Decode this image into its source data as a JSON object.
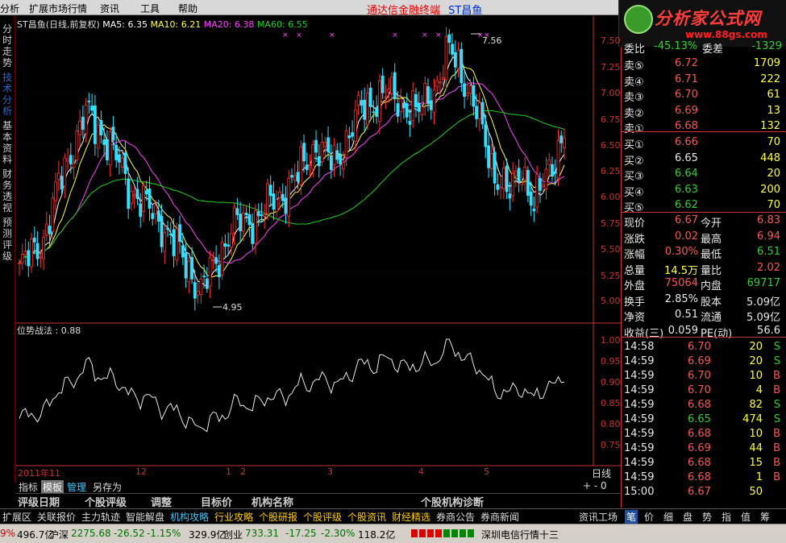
{
  "menubar": {
    "items": [
      "分析",
      "扩展市场行情",
      "资讯",
      "工具",
      "帮助"
    ],
    "center_title": "通达信金融终端",
    "stock_name": "ST昌鱼"
  },
  "logo": {
    "text": "分析家公式网",
    "url": "www.88gs.com"
  },
  "leftnav": {
    "items": [
      "分时走势",
      "技术分析",
      "基本资料",
      "财务透视",
      "预测评级"
    ],
    "active": 1
  },
  "chart": {
    "header": {
      "name": "ST昌鱼(日线,前复权)",
      "ma5": "MA5: 6.35",
      "ma10": "MA10: 6.21",
      "ma20": "MA20: 6.38",
      "ma60": "MA60: 6.55"
    },
    "high_label": "7.56",
    "low_label": "4.95",
    "y_ticks": [
      "7.50",
      "7.25",
      "7.00",
      "6.75",
      "6.50",
      "6.25",
      "6.00",
      "5.75",
      "5.50",
      "5.25",
      "5.00"
    ],
    "colors": {
      "up": "#ff3030",
      "down": "#33e0ff",
      "ma5": "#ffffff",
      "ma10": "#ffff40",
      "ma20": "#ff40ff",
      "ma60": "#20d020"
    }
  },
  "indicator": {
    "header": "位势战法 : 0.88",
    "y_ticks": [
      "1.00",
      "0.95",
      "0.90",
      "0.85",
      "0.80",
      "0.75"
    ]
  },
  "time_axis": {
    "labels": [
      "2011年11",
      "12",
      "1",
      "2",
      "3",
      "4",
      "5"
    ],
    "period": "日线"
  },
  "quote": {
    "header": {
      "l1": "委比",
      "v1": "-45.13%",
      "l2": "委差",
      "v2": "-1329"
    },
    "sells": [
      {
        "label": "卖⑤",
        "price": "6.72",
        "vol": "1709"
      },
      {
        "label": "卖④",
        "price": "6.71",
        "vol": "222"
      },
      {
        "label": "卖③",
        "price": "6.70",
        "vol": "61"
      },
      {
        "label": "卖②",
        "price": "6.69",
        "vol": "13"
      },
      {
        "label": "卖①",
        "price": "6.68",
        "vol": "132"
      }
    ],
    "buys": [
      {
        "label": "买①",
        "price": "6.66",
        "vol": "70"
      },
      {
        "label": "买②",
        "price": "6.65",
        "vol": "448"
      },
      {
        "label": "买③",
        "price": "6.64",
        "vol": "20"
      },
      {
        "label": "买④",
        "price": "6.63",
        "vol": "200"
      },
      {
        "label": "买⑤",
        "price": "6.62",
        "vol": "70"
      }
    ],
    "stats": [
      {
        "l1": "现价",
        "v1": "6.67",
        "l2": "今开",
        "v2": "6.83"
      },
      {
        "l1": "涨跌",
        "v1": "0.02",
        "l2": "最高",
        "v2": "6.94"
      },
      {
        "l1": "涨幅",
        "v1": "0.30%",
        "l2": "最低",
        "v2": "6.51"
      },
      {
        "l1": "总量",
        "v1": "14.5万",
        "l2": "量比",
        "v2": "2.02"
      },
      {
        "l1": "外盘",
        "v1": "75064",
        "l2": "内盘",
        "v2": "69717"
      },
      {
        "l1": "换手",
        "v1": "2.85%",
        "l2": "股本",
        "v2": "5.09亿"
      },
      {
        "l1": "净资",
        "v1": "0.51",
        "l2": "流通",
        "v2": "5.09亿"
      },
      {
        "l1": "收益(三)",
        "v1": "0.059",
        "l2": "PE(动)",
        "v2": "56.6"
      }
    ],
    "ticks": [
      {
        "time": "14:58",
        "price": "6.70",
        "vol": "20",
        "bs": "S"
      },
      {
        "time": "14:59",
        "price": "6.69",
        "vol": "20",
        "bs": "S"
      },
      {
        "time": "14:59",
        "price": "6.70",
        "vol": "10",
        "bs": "B"
      },
      {
        "time": "14:59",
        "price": "6.70",
        "vol": "4",
        "bs": "B"
      },
      {
        "time": "14:59",
        "price": "6.68",
        "vol": "82",
        "bs": "S"
      },
      {
        "time": "14:59",
        "price": "6.65",
        "vol": "474",
        "bs": "S"
      },
      {
        "time": "14:59",
        "price": "6.68",
        "vol": "10",
        "bs": "B"
      },
      {
        "time": "14:59",
        "price": "6.69",
        "vol": "44",
        "bs": "B"
      },
      {
        "time": "14:59",
        "price": "6.68",
        "vol": "15",
        "bs": "B"
      },
      {
        "time": "14:59",
        "price": "6.68",
        "vol": "1",
        "bs": "B"
      },
      {
        "time": "15:00",
        "price": "6.67",
        "vol": "50",
        "bs": ""
      }
    ]
  },
  "tabs": {
    "items": [
      "指标",
      "模板",
      "管理",
      "另存为"
    ],
    "zoom": "+ - 0"
  },
  "rating": {
    "items": [
      "评级日期",
      "个股评级",
      "调整",
      "目标价",
      "机构名称",
      "个股机构诊断"
    ]
  },
  "bottom_tabs": {
    "left": [
      "扩展区",
      "关联报价",
      "主力轨迹",
      "智能解盘",
      "机构攻略",
      "行业攻略",
      "个股研报",
      "个股评级",
      "个股资讯",
      "财经精选",
      "券商公告",
      "券商新闻"
    ],
    "news": "资讯工场",
    "right": [
      "笔",
      "价",
      "细",
      "盘",
      "势",
      "指",
      "值",
      "筹"
    ]
  },
  "statusbar": {
    "items": [
      {
        "text": "9%",
        "cls": "r"
      },
      {
        "text": "496.7亿",
        "cls": ""
      },
      {
        "text": "沪深",
        "cls": ""
      },
      {
        "text": "2275.68",
        "cls": "g"
      },
      {
        "text": "-26.52",
        "cls": "g"
      },
      {
        "text": "-1.15%",
        "cls": "g"
      },
      {
        "text": "329.9亿",
        "cls": ""
      },
      {
        "text": "创业",
        "cls": ""
      },
      {
        "text": "733.31",
        "cls": "g"
      },
      {
        "text": "-17.25",
        "cls": "g"
      },
      {
        "text": "-2.30%",
        "cls": "g"
      },
      {
        "text": "118.2亿",
        "cls": ""
      }
    ],
    "right_text": "深圳电信行情十三"
  }
}
